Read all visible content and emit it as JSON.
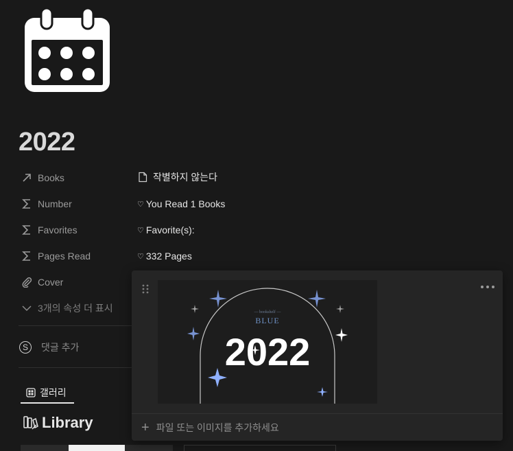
{
  "page": {
    "icon": "calendar-icon",
    "title": "2022"
  },
  "properties": [
    {
      "icon": "arrow-up-right-icon",
      "label": "Books",
      "value": "작별하지 않는다",
      "value_icon": "page-icon"
    },
    {
      "icon": "sigma-icon",
      "label": "Number",
      "value": "You Read 1 Books",
      "value_icon": "heart-icon"
    },
    {
      "icon": "sigma-icon",
      "label": "Favorites",
      "value": "Favorite(s):",
      "value_icon": "heart-icon"
    },
    {
      "icon": "sigma-icon",
      "label": "Pages Read",
      "value": "332 Pages",
      "value_icon": "heart-icon"
    },
    {
      "icon": "paperclip-icon",
      "label": "Cover"
    }
  ],
  "more_properties": "3개의 속성 더 표시",
  "comment": {
    "icon_glyph": "S",
    "label": "댓글 추가"
  },
  "views": {
    "gallery_label": "갤러리"
  },
  "database": {
    "title": "Library"
  },
  "popup": {
    "cover": {
      "year": "2022",
      "brand": "BLUE",
      "small_text": "— bookshelf —"
    },
    "add_file_label": "파일 또는 이미지를 추가하세요"
  },
  "colors": {
    "background": "#191919",
    "popup": "#252525",
    "accent_star": "#8fb0ff"
  }
}
